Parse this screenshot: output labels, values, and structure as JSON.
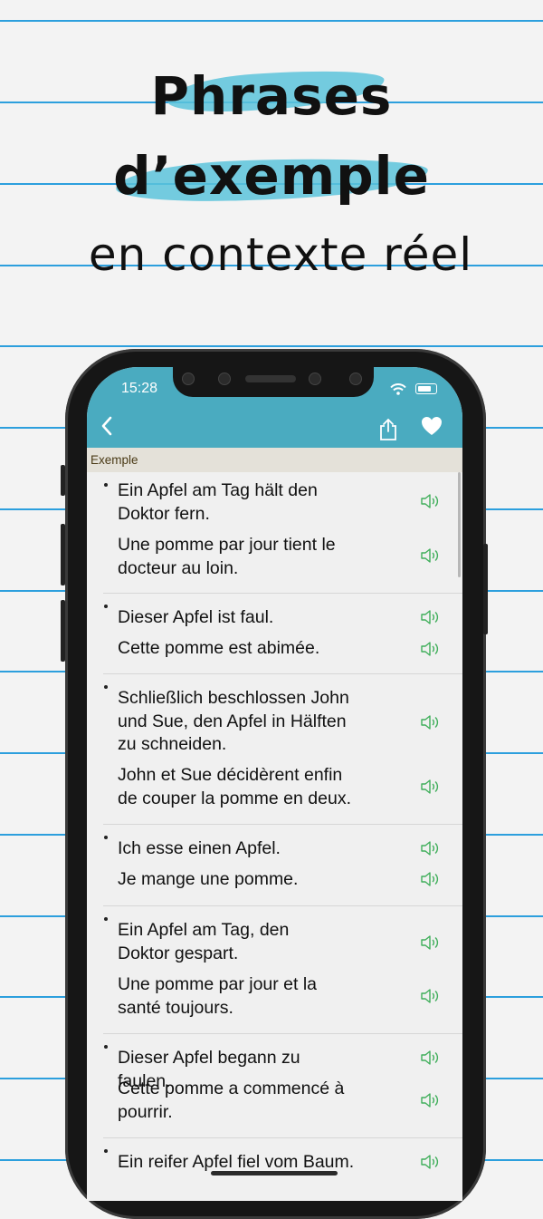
{
  "headline": {
    "line1": "Phrases",
    "line2": "d’exemple",
    "line3": "en contexte réel"
  },
  "status_bar": {
    "time": "15:28"
  },
  "nav": {
    "back_icon": "chevron-left-icon",
    "share_icon": "share-icon",
    "favorite_icon": "heart-icon"
  },
  "section": {
    "title": "Exemple"
  },
  "examples": [
    {
      "de": "Ein Apfel am Tag hält den Doktor fern.",
      "fr": "Une pomme par jour tient le docteur au loin."
    },
    {
      "de": "Dieser Apfel ist faul.",
      "fr": "Cette pomme est abimée."
    },
    {
      "de": "Schließlich beschlossen John und Sue, den Apfel in Hälften zu schneiden.",
      "fr": "John et Sue décidèrent enfin de couper la pomme en deux."
    },
    {
      "de": "Ich esse einen Apfel.",
      "fr": "Je mange une pomme."
    },
    {
      "de": "Ein Apfel am Tag, den Doktor gespart.",
      "fr": "Une pomme par jour et la santé toujours."
    },
    {
      "de": "Dieser Apfel begann zu faulen.",
      "fr": "Cette pomme a commencé à pourrir."
    },
    {
      "de": "Ein reifer Apfel fiel vom Baum.",
      "fr": ""
    }
  ],
  "colors": {
    "accent": "#4aabc0",
    "speaker_icon": "#3fae5a",
    "paper_lines": "#2c9fdd",
    "brush": "#5cc3da"
  }
}
